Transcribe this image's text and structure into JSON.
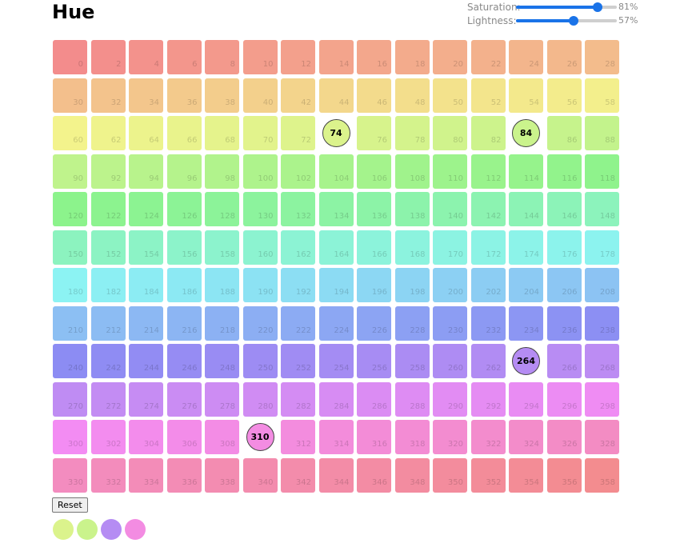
{
  "title": "Hue",
  "controls": {
    "saturation": {
      "label": "Saturation:",
      "value": 81,
      "display": "81%"
    },
    "lightness": {
      "label": "Lightness:",
      "value": 57,
      "display": "57%"
    }
  },
  "grid": {
    "columns": 15,
    "hue_start": 0,
    "hue_step": 2,
    "count": 180,
    "selected": [
      74,
      84,
      264,
      310
    ]
  },
  "reset_label": "Reset",
  "swatch_hues": [
    74,
    84,
    264,
    310
  ]
}
